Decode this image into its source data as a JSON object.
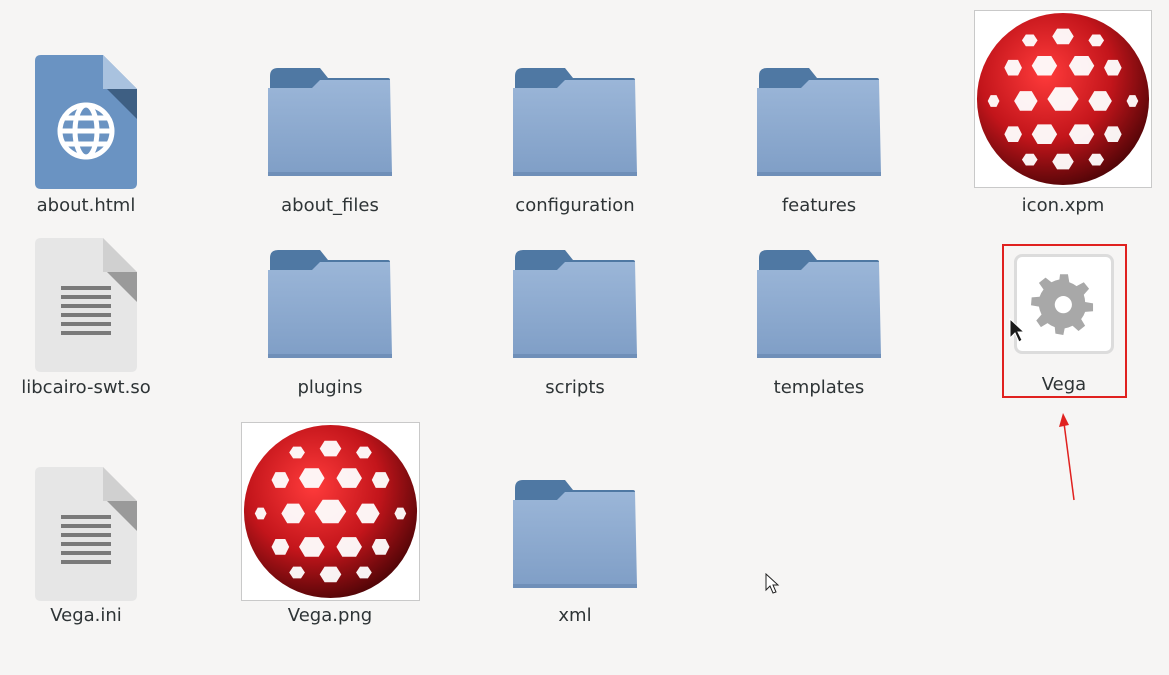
{
  "files": [
    {
      "name": "about.html",
      "type": "html-file"
    },
    {
      "name": "about_files",
      "type": "folder"
    },
    {
      "name": "configuration",
      "type": "folder"
    },
    {
      "name": "features",
      "type": "folder"
    },
    {
      "name": "icon.xpm",
      "type": "image-thumbnail"
    },
    {
      "name": "libcairo-swt.so",
      "type": "text-file"
    },
    {
      "name": "plugins",
      "type": "folder"
    },
    {
      "name": "scripts",
      "type": "folder"
    },
    {
      "name": "templates",
      "type": "folder"
    },
    {
      "name": "Vega",
      "type": "executable",
      "selected": true
    },
    {
      "name": "Vega.ini",
      "type": "text-file"
    },
    {
      "name": "Vega.png",
      "type": "image-thumbnail"
    },
    {
      "name": "xml",
      "type": "folder"
    }
  ],
  "colors": {
    "background": "#f6f5f4",
    "folder_front": "#8ba9cf",
    "folder_back": "#4f78a3",
    "annotation_red": "#e0211f",
    "sphere_red": "#b0161c"
  }
}
